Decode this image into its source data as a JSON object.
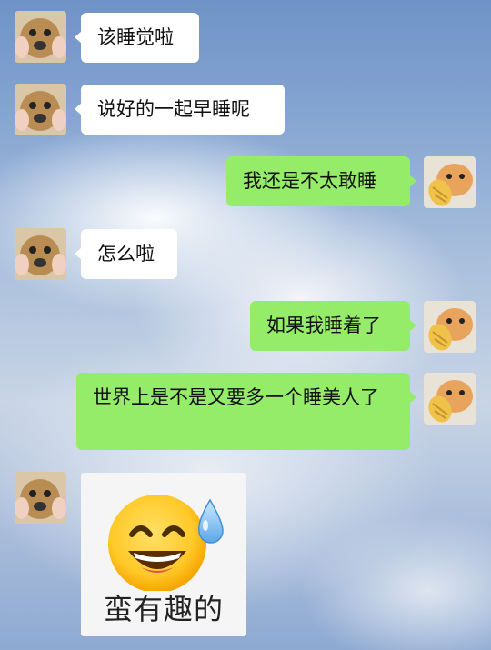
{
  "messages": [
    {
      "side": "left",
      "text": "该睡觉啦"
    },
    {
      "side": "left",
      "text": "说好的一起早睡呢"
    },
    {
      "side": "right",
      "text": "我还是不太敢睡"
    },
    {
      "side": "left",
      "text": "怎么啦"
    },
    {
      "side": "right",
      "text": "如果我睡着了"
    },
    {
      "side": "right",
      "text": "世界上是不是又要多一个睡美人了"
    },
    {
      "side": "left",
      "type": "sticker",
      "caption": "蛮有趣的",
      "icon": "sweat-smile-emoji"
    }
  ],
  "colors": {
    "left_bubble": "#ffffff",
    "right_bubble": "#95ec69"
  }
}
